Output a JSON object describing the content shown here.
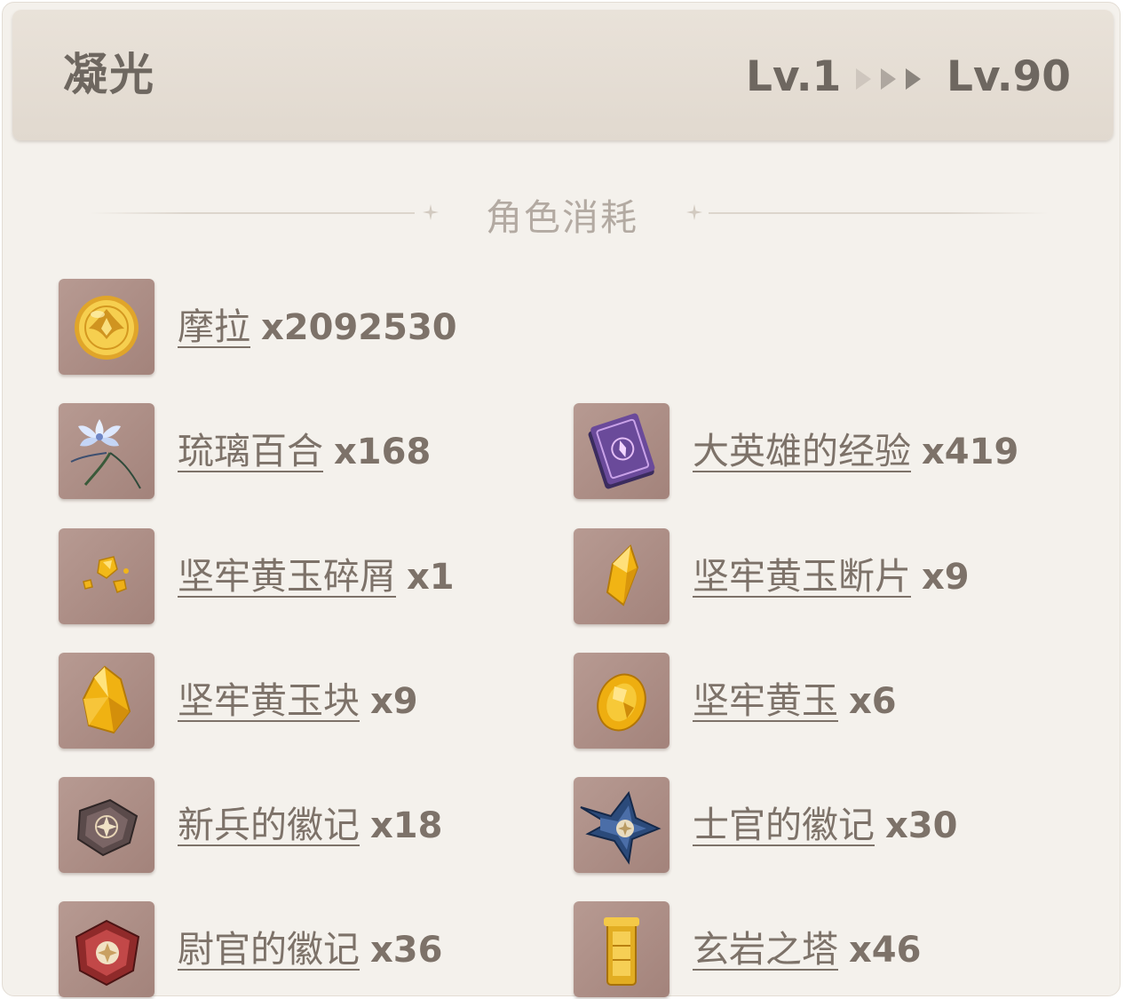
{
  "header": {
    "character_name": "凝光",
    "level_from": "Lv.1",
    "level_to": "Lv.90"
  },
  "section": {
    "title": "角色消耗"
  },
  "materials": [
    {
      "name": "摩拉",
      "count": "x2092530",
      "icon": "mora-coin-icon"
    },
    {
      "name": "琉璃百合",
      "count": "x168",
      "icon": "glaze-lily-icon"
    },
    {
      "name": "大英雄的经验",
      "count": "x419",
      "icon": "heros-wit-book-icon"
    },
    {
      "name": "坚牢黄玉碎屑",
      "count": "x1",
      "icon": "topaz-sliver-icon"
    },
    {
      "name": "坚牢黄玉断片",
      "count": "x9",
      "icon": "topaz-fragment-icon"
    },
    {
      "name": "坚牢黄玉块",
      "count": "x9",
      "icon": "topaz-chunk-icon"
    },
    {
      "name": "坚牢黄玉",
      "count": "x6",
      "icon": "topaz-gemstone-icon"
    },
    {
      "name": "新兵的徽记",
      "count": "x18",
      "icon": "recruit-insignia-icon"
    },
    {
      "name": "士官的徽记",
      "count": "x30",
      "icon": "sergeant-insignia-icon"
    },
    {
      "name": "尉官的徽记",
      "count": "x36",
      "icon": "lieutenant-insignia-icon"
    },
    {
      "name": "玄岩之塔",
      "count": "x46",
      "icon": "basalt-pillar-icon"
    }
  ]
}
